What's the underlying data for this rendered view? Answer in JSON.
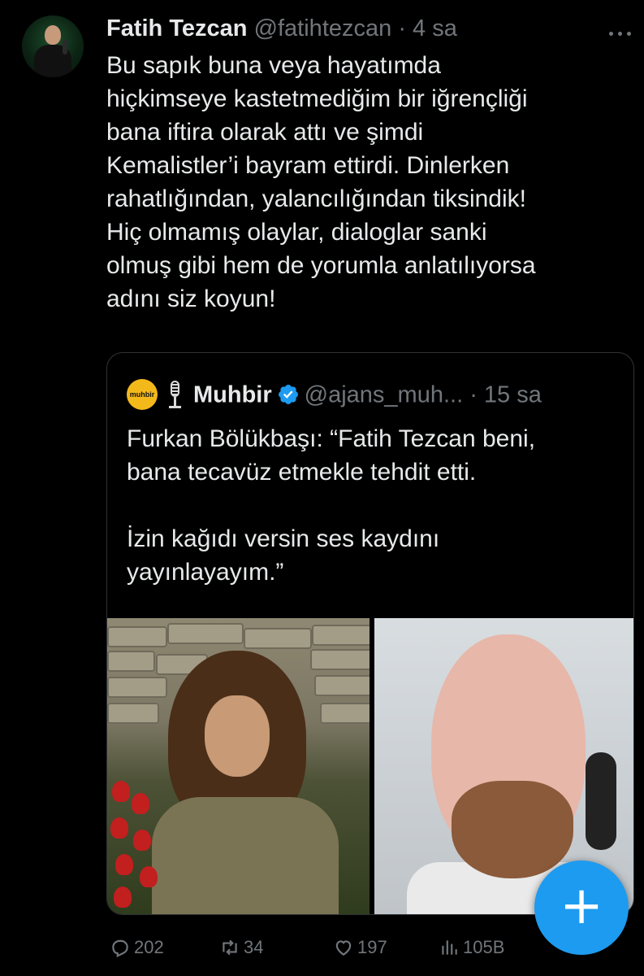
{
  "tweet": {
    "author_name": "Fatih Tezcan",
    "author_handle": "@fatihtezcan",
    "separator": " · ",
    "time": "4 sa",
    "text": "Bu sapık buna veya hayatımda\nhiçkimseye kastetmediğim bir iğrençliği\nbana iftira olarak attı ve şimdi\nKemalistler’i bayram ettirdi. Dinlerken\nrahatlığından, yalancılığından tiksindik!\nHiç olmamış olaylar, dialoglar sanki\nolmuş gibi hem de yorumla anlatılıyorsa\nadını siz koyun!"
  },
  "quote": {
    "logo_text": "muhbir",
    "author_name": "Muhbir",
    "author_handle": "@ajans_muh...",
    "separator": " · ",
    "time": "15 sa",
    "text": "Furkan Bölükbaşı: “Fatih Tezcan beni,\nbana tecavüz etmekle tehdit etti.\n\nİzin kağıdı versin ses kaydını\nyayınlayayım.”"
  },
  "actions": {
    "replies": "202",
    "reposts": "34",
    "likes": "197",
    "views": "105B"
  },
  "icons": {
    "reply": "reply-icon",
    "repost": "repost-icon",
    "like": "heart-icon",
    "views": "views-icon",
    "compose": "plus-icon",
    "more": "more-icon",
    "verified": "verified-badge-icon"
  },
  "colors": {
    "background": "#000000",
    "text": "#e7e9ea",
    "muted": "#71767b",
    "accent": "#1d9bf0",
    "border": "#2f3336"
  }
}
